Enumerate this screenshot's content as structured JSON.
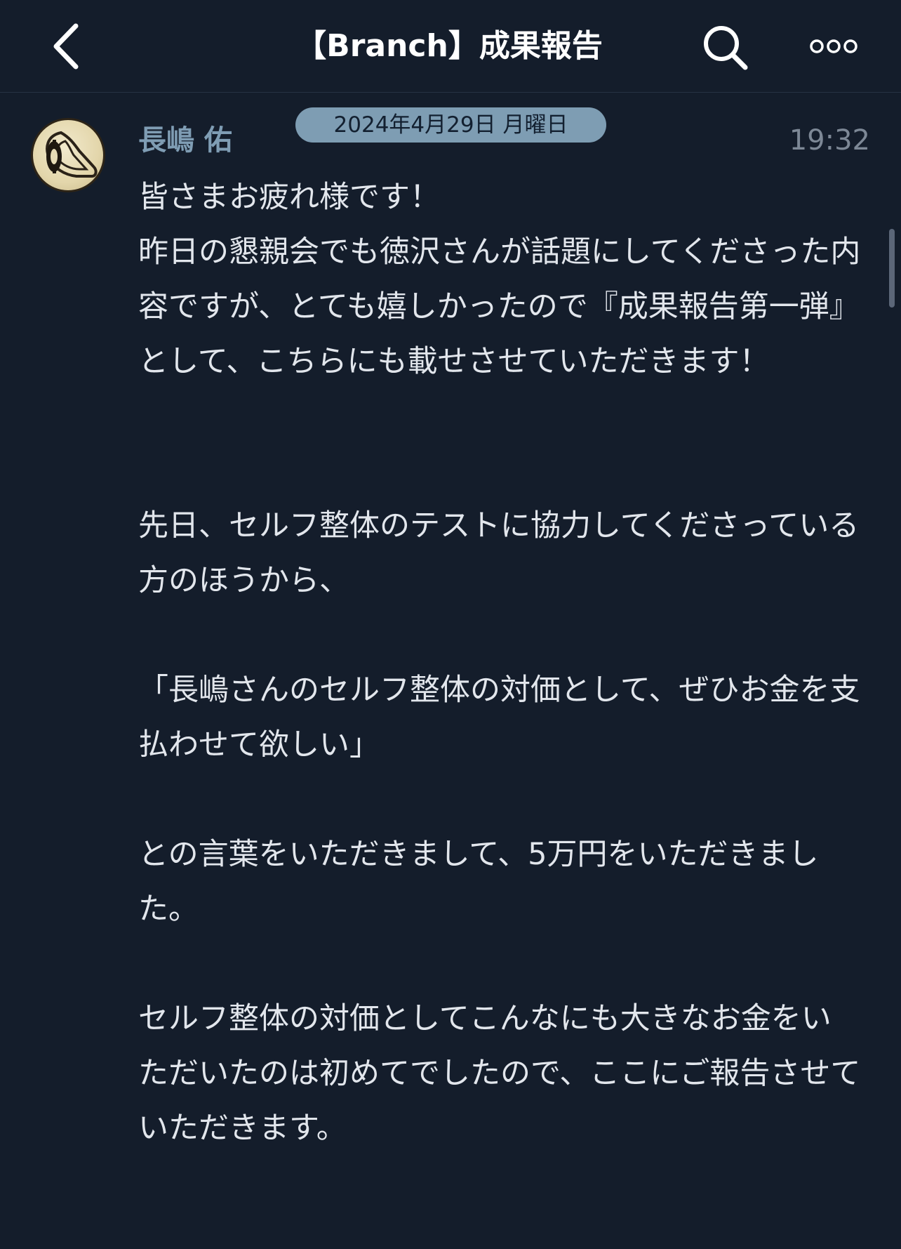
{
  "header": {
    "title": "【Branch】成果報告",
    "back_icon": "chevron-left-icon",
    "search_icon": "search-icon",
    "more_icon": "more-dots-icon"
  },
  "date_separator": "2024年4月29日 月曜日",
  "message": {
    "sender": "長嶋 佑",
    "time": "19:32",
    "paragraphs": [
      "皆さまお疲れ様です！\n昨日の懇親会でも徳沢さんが話題にしてくださった内容ですが、とても嬉しかったので『成果報告第一弾』として、こちらにも載せさせていただきます！",
      "先日、セルフ整体のテストに協力してくださっている方のほうから、",
      "「長嶋さんのセルフ整体の対価として、ぜひお金を支払わせて欲しい」",
      "との言葉をいただきまして、5万円をいただきました。",
      "セルフ整体の対価としてこんなにも大きなお金をいただいたのは初めてでしたので、ここにご報告させていただきます。"
    ]
  },
  "colors": {
    "background": "#141d2b",
    "date_pill": "#7e9db3",
    "sender_name": "#7f9db4",
    "body_text": "#e2e6ec",
    "time_text": "#7d8896"
  }
}
